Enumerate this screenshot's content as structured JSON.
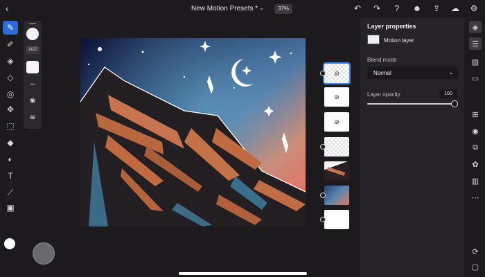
{
  "app": {
    "document_title": "New Motion Presets *",
    "zoom": "37%"
  },
  "top_bar": {
    "back_icon": "chevron-left-icon",
    "title_chevron_icon": "chevron-down-icon",
    "actions": [
      {
        "name": "undo-icon",
        "glyph": "↶"
      },
      {
        "name": "redo-icon",
        "glyph": "↷"
      },
      {
        "name": "help-icon",
        "glyph": "?"
      },
      {
        "name": "user-icon",
        "glyph": "☻"
      },
      {
        "name": "share-icon",
        "glyph": "⇪"
      },
      {
        "name": "cloud-icon",
        "glyph": "☁"
      },
      {
        "name": "gear-icon",
        "glyph": "⚙"
      }
    ]
  },
  "left_tools": [
    {
      "name": "paint-brush-tool-icon",
      "glyph": "✎",
      "active": true
    },
    {
      "name": "smudge-tool-icon",
      "glyph": "✐",
      "active": false
    },
    {
      "name": "fill-tool-icon",
      "glyph": "◈",
      "active": false
    },
    {
      "name": "eraser-tool-icon",
      "glyph": "◇",
      "active": false
    },
    {
      "name": "lasso-tool-icon",
      "glyph": "◎",
      "active": false
    },
    {
      "name": "move-tool-icon",
      "glyph": "✥",
      "active": false
    },
    {
      "name": "transform-tool-icon",
      "glyph": "⬚",
      "active": false
    },
    {
      "name": "paint-bucket-icon",
      "glyph": "◆",
      "active": false
    },
    {
      "name": "shape-tool-icon",
      "glyph": "◐",
      "active": false
    },
    {
      "name": "text-tool-icon",
      "glyph": "T",
      "active": false
    },
    {
      "name": "eyedropper-icon",
      "glyph": "⟋",
      "active": false
    },
    {
      "name": "image-icon",
      "glyph": "▣",
      "active": false
    }
  ],
  "brush_panel": {
    "size_value": "1422",
    "tools": [
      {
        "name": "brush-stroke-icon",
        "glyph": "∼"
      },
      {
        "name": "brush-blend-icon",
        "glyph": "❀"
      },
      {
        "name": "brush-settings-icon",
        "glyph": "≋"
      }
    ]
  },
  "layers": [
    {
      "name": "layer-thumb-motion",
      "type": "checker",
      "selected": true,
      "dot": true,
      "hidden": true
    },
    {
      "name": "layer-thumb-2",
      "type": "white",
      "selected": false,
      "dot": false,
      "hidden": true
    },
    {
      "name": "layer-thumb-3",
      "type": "white",
      "selected": false,
      "dot": false,
      "hidden": true
    },
    {
      "name": "layer-thumb-4",
      "type": "checker",
      "selected": false,
      "dot": true,
      "hidden": false
    },
    {
      "name": "layer-thumb-mountain",
      "type": "mountain",
      "selected": false,
      "dot": false,
      "hidden": false
    },
    {
      "name": "layer-thumb-sky",
      "type": "sky",
      "selected": false,
      "dot": true,
      "hidden": false
    },
    {
      "name": "layer-thumb-background",
      "type": "white",
      "selected": false,
      "dot": true,
      "hidden": false
    }
  ],
  "properties": {
    "title": "Layer properties",
    "layer_name": "Motion layer",
    "blend_mode_label": "Blend mode",
    "blend_mode_value": "Normal",
    "opacity_label": "Layer opacity",
    "opacity_value": "100",
    "opacity_level": 1.0
  },
  "right_rail": [
    {
      "name": "layers-icon",
      "glyph": "◈",
      "active": true
    },
    {
      "name": "adjustments-icon",
      "glyph": "☰",
      "active": true
    },
    {
      "name": "properties-icon",
      "glyph": "▤",
      "active": false
    },
    {
      "name": "comment-icon",
      "glyph": "▭",
      "active": false
    },
    {
      "name": "add-layer-icon",
      "glyph": "⊞",
      "active": false
    },
    {
      "name": "visibility-icon",
      "glyph": "◉",
      "active": false
    },
    {
      "name": "mask-icon",
      "glyph": "⧉",
      "active": false
    },
    {
      "name": "blend-icon",
      "glyph": "✿",
      "active": false
    },
    {
      "name": "delete-layer-icon",
      "glyph": "▥",
      "active": false
    },
    {
      "name": "more-icon",
      "glyph": "⋯",
      "active": false
    },
    {
      "name": "timeline-icon",
      "glyph": "⟳",
      "active": false
    },
    {
      "name": "fullscreen-icon",
      "glyph": "▢",
      "active": false
    }
  ],
  "colors": {
    "accent": "#2d6bd6",
    "selection": "#3c86f0",
    "background": "#1c1a1d",
    "panel": "#252327"
  }
}
